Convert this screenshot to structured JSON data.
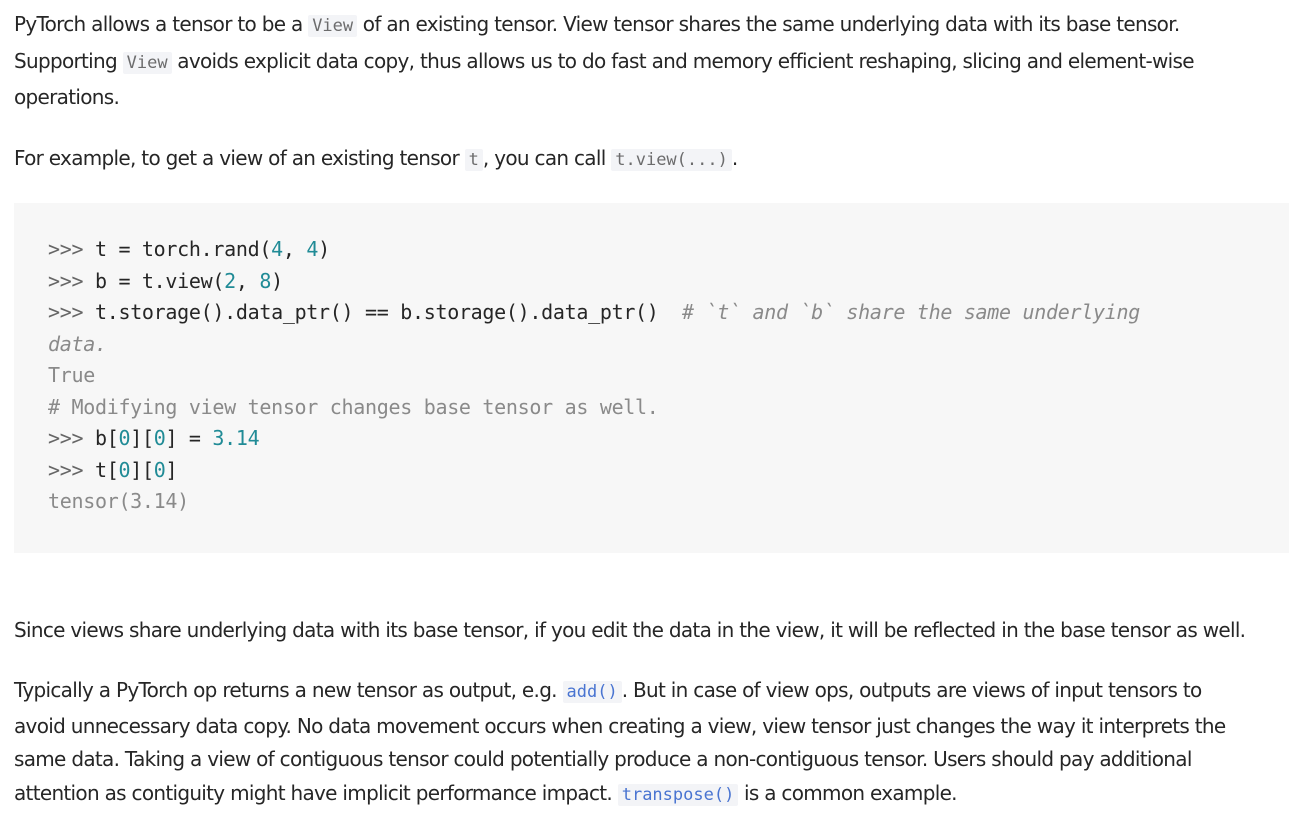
{
  "para1": {
    "line1": {
      "before": "PyTorch allows a tensor to be a ",
      "code": "View",
      "after": " of an existing tensor. View tensor shares the same underlying data with its base tensor."
    },
    "line2": {
      "before": "Supporting ",
      "code": "View",
      "after": " avoids explicit data copy, thus allows us to do fast and memory efficient reshaping, slicing and element-wise"
    },
    "line3": "operations."
  },
  "para2": {
    "before": "For example, to get a view of an existing tensor ",
    "code1": "t",
    "mid": ", you can call ",
    "code2": "t.view(...)",
    "after": "."
  },
  "code": {
    "prompt": ">>> ",
    "l1": {
      "a": "t = torch.rand(",
      "n1": "4",
      "sep": ", ",
      "n2": "4",
      "b": ")"
    },
    "l2": {
      "a": "b = t.view(",
      "n1": "2",
      "sep": ", ",
      "n2": "8",
      "b": ")"
    },
    "l3": {
      "a": "t.storage().data_ptr() == b.storage().data_ptr()",
      "comment": "  # `t` and `b` share the same underlying"
    },
    "l3_wrap": "data.",
    "l4": "True",
    "l5": "# Modifying view tensor changes base tensor as well.",
    "l6": {
      "a": "b[",
      "n1": "0",
      "m": "][",
      "n2": "0",
      "b": "] = ",
      "n3": "3.14"
    },
    "l7": {
      "a": "t[",
      "n1": "0",
      "m": "][",
      "n2": "0",
      "b": "]"
    },
    "l8": "tensor(3.14)"
  },
  "para3": "Since views share underlying data with its base tensor, if you edit the data in the view, it will be reflected in the base tensor as well.",
  "para4": {
    "line1": {
      "before": "Typically a PyTorch op returns a new tensor as output, e.g. ",
      "code": "add()",
      "after": ". But in case of view ops, outputs are views of input tensors to"
    },
    "line2": "avoid unnecessary data copy. No data movement occurs when creating a view, view tensor just changes the way it interprets the",
    "line3": "same data. Taking a view of contiguous tensor could potentially produce a non-contiguous tensor. Users should pay additional",
    "line4": {
      "before": "attention as contiguity might have implicit performance impact. ",
      "code": "transpose()",
      "after": " is a common example."
    }
  },
  "colors": {
    "text": "#262626",
    "code_bg": "#f7f7f7",
    "number": "#208b96",
    "link_code": "#4974d1"
  }
}
